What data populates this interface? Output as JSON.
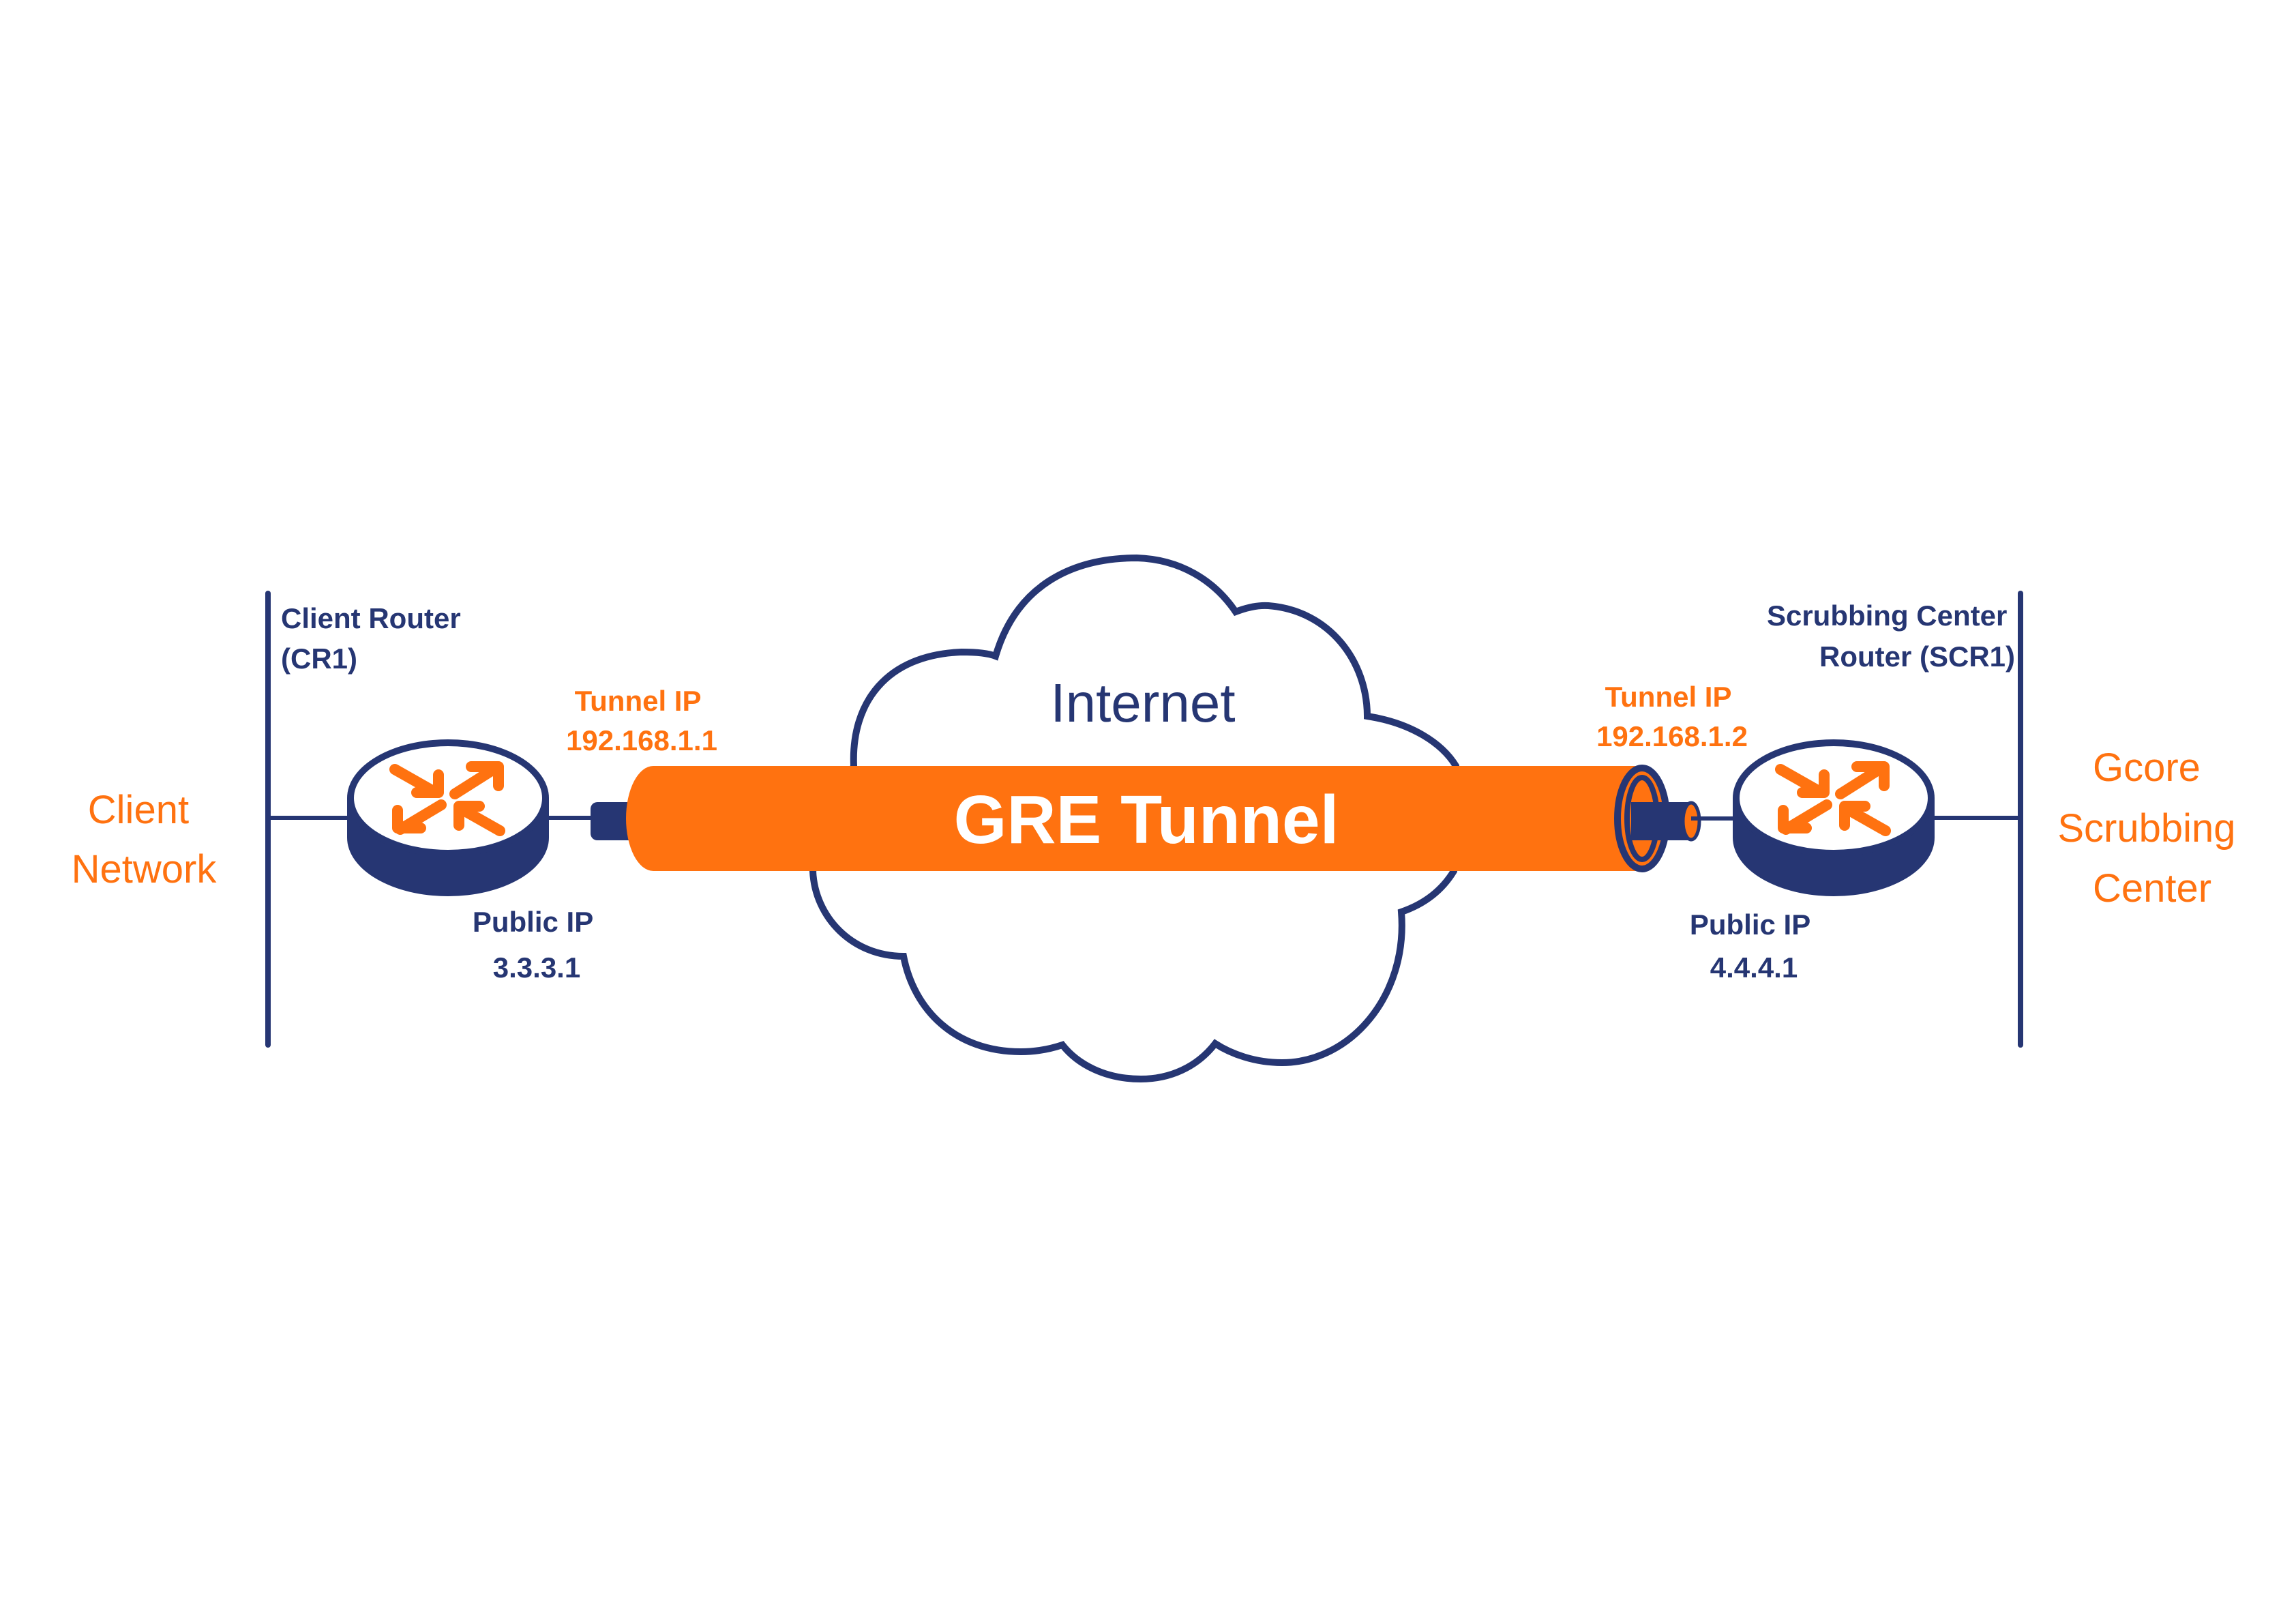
{
  "diagram": {
    "title": "GRE Tunnel",
    "colors": {
      "navy": "#263673",
      "orange": "#ff7210",
      "background": "#ffffff"
    },
    "left_network": {
      "name_lines": [
        "Client",
        "Network"
      ]
    },
    "right_network": {
      "name_lines": [
        "Gcore",
        "Scrubbing",
        "Center"
      ]
    },
    "client_router": {
      "label_lines": [
        "Client Router",
        "(CR1)"
      ],
      "tunnel_ip_label": "Tunnel IP",
      "tunnel_ip": "192.168.1.1",
      "public_ip_label": "Public IP",
      "public_ip": "3.3.3.1",
      "icon": "router-icon"
    },
    "scrubbing_router": {
      "label_lines": [
        "Scrubbing Center",
        "Router (SCR1)"
      ],
      "tunnel_ip_label": "Tunnel IP",
      "tunnel_ip": "192.168.1.2",
      "public_ip_label": "Public IP",
      "public_ip": "4.4.4.1",
      "icon": "router-icon"
    },
    "cloud": {
      "label": "Internet",
      "icon": "cloud-icon"
    },
    "tunnel": {
      "label": "GRE Tunnel",
      "icon": "pipe-icon"
    }
  }
}
